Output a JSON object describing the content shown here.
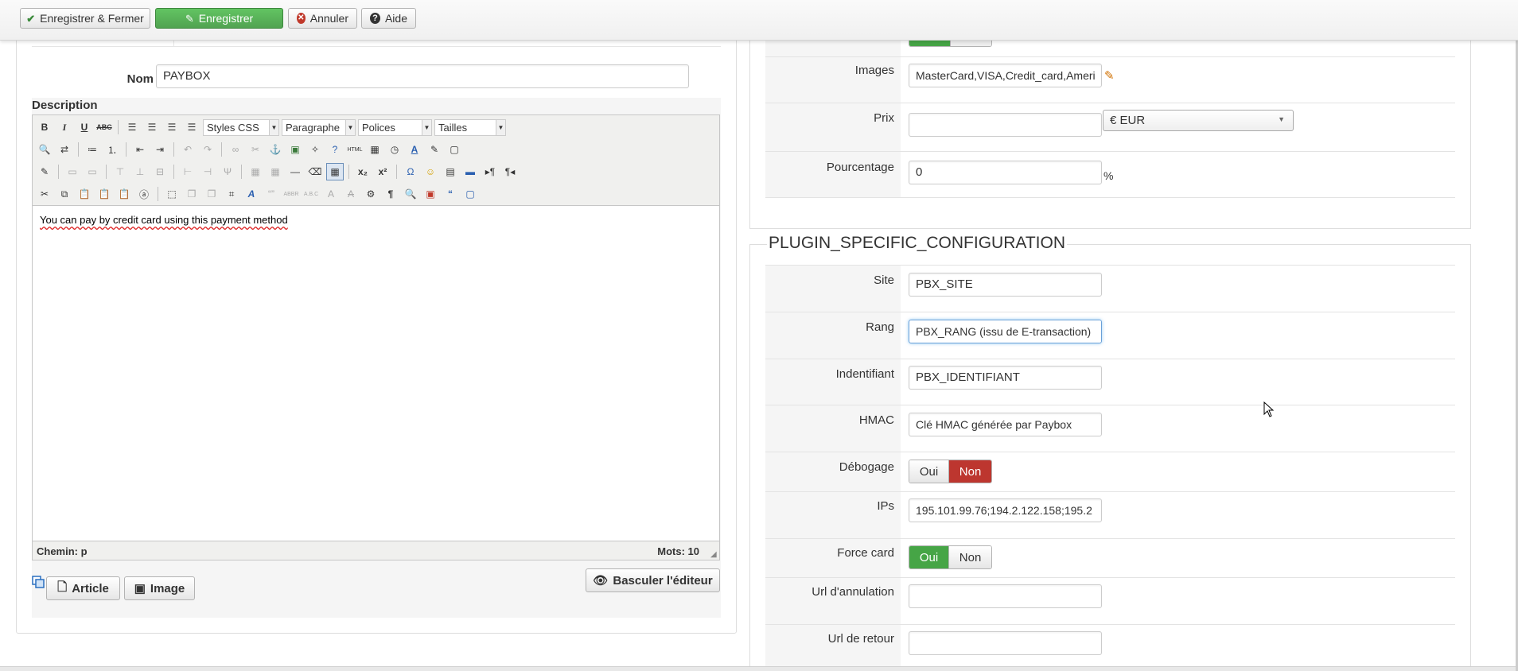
{
  "toolbar": {
    "save_close": "Enregistrer & Fermer",
    "save": "Enregistrer",
    "cancel": "Annuler",
    "help": "Aide"
  },
  "left": {
    "name_label": "Nom",
    "name_value": "PAYBOX",
    "description_label": "Description",
    "editor": {
      "styles_select": "Styles CSS",
      "paragraph_select": "Paragraphe",
      "fonts_select": "Polices",
      "sizes_select": "Tailles",
      "content": "You can pay by credit card using this payment method",
      "path": "Chemin: p",
      "word_count": "Mots: 10"
    },
    "article_button": "Article",
    "image_button": "Image",
    "toggle_editor_button": "Basculer l'éditeur"
  },
  "right_top": {
    "images_label": "Images",
    "images_value": "MasterCard,VISA,Credit_card,Ameri",
    "price_label": "Prix",
    "price_value": "",
    "currency_value": "€ EUR",
    "percent_label": "Pourcentage",
    "percent_value": "0",
    "percent_unit": "%"
  },
  "plugin": {
    "legend": "PLUGIN_SPECIFIC_CONFIGURATION",
    "site_label": "Site",
    "site_value": "PBX_SITE",
    "rank_label": "Rang",
    "rank_value": "PBX_RANG (issu de E-transaction)",
    "ident_label": "Indentifiant",
    "ident_value": "PBX_IDENTIFIANT",
    "hmac_label": "HMAC",
    "hmac_value": "Clé HMAC générée par Paybox",
    "debug_label": "Débogage",
    "debug_yes": "Oui",
    "debug_no": "Non",
    "ips_label": "IPs",
    "ips_value": "195.101.99.76;194.2.122.158;195.2",
    "force_card_label": "Force card",
    "force_yes": "Oui",
    "force_no": "Non",
    "cancel_url_label": "Url d'annulation",
    "cancel_url_value": "",
    "return_url_label": "Url de retour",
    "return_url_value": ""
  },
  "colors": {
    "green": "#51a351",
    "red": "#bd362f"
  }
}
